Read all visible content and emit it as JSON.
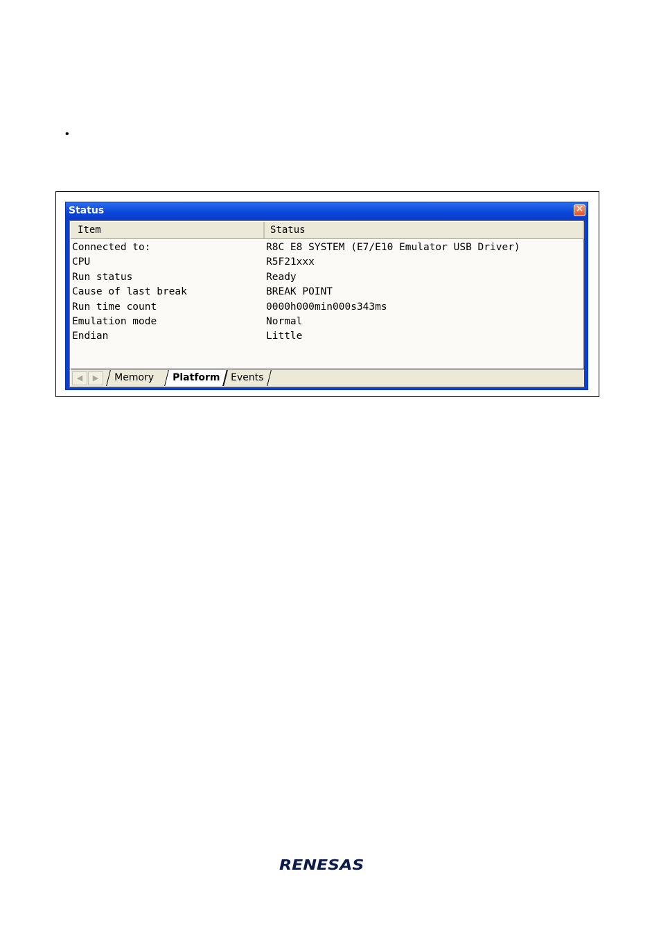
{
  "bullet": "•",
  "window": {
    "title": "Status",
    "close_glyph": "✕"
  },
  "table": {
    "columns": [
      "Item",
      "Status"
    ],
    "rows": [
      {
        "item": "Connected to:",
        "status": "R8C E8 SYSTEM (E7/E10 Emulator USB Driver)"
      },
      {
        "item": "CPU",
        "status": "R5F21xxx"
      },
      {
        "item": "Run status",
        "status": "Ready"
      },
      {
        "item": "Cause of last break",
        "status": "BREAK POINT"
      },
      {
        "item": "Run time count",
        "status": "0000h000min000s343ms"
      },
      {
        "item": "Emulation mode",
        "status": "Normal"
      },
      {
        "item": "Endian",
        "status": "Little"
      }
    ]
  },
  "tabs": {
    "scroll_left_glyph": "◀",
    "scroll_right_glyph": "▶",
    "items": [
      "Memory",
      "Platform",
      "Events"
    ],
    "active": "Platform"
  },
  "footer": {
    "logo": "RENESAS"
  }
}
